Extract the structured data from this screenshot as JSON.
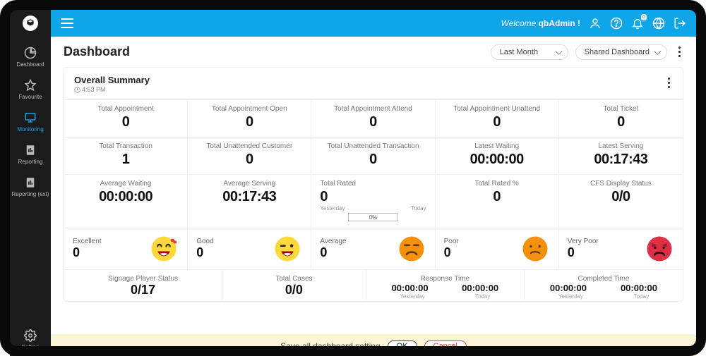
{
  "sidebar": {
    "items": [
      {
        "label": "Dashboard"
      },
      {
        "label": "Favourite"
      },
      {
        "label": "Monitoring"
      },
      {
        "label": "Reporting"
      },
      {
        "label": "Reporting (ext)"
      }
    ],
    "setting_label": "Setting"
  },
  "topbar": {
    "welcome_prefix": "Welcome",
    "user": "qbAdmin !",
    "notif_badge": "0"
  },
  "page": {
    "title": "Dashboard",
    "period_select": "Last Month",
    "dashboard_select": "Shared Dashboard"
  },
  "summary": {
    "title": "Overall Summary",
    "time": "4:53 PM",
    "row1": [
      {
        "label": "Total Appointment",
        "value": "0"
      },
      {
        "label": "Total Appointment Open",
        "value": "0"
      },
      {
        "label": "Total Appointment Attend",
        "value": "0"
      },
      {
        "label": "Total Appointment Unattend",
        "value": "0"
      },
      {
        "label": "Total Ticket",
        "value": "0"
      }
    ],
    "row2": [
      {
        "label": "Total Transaction",
        "value": "1"
      },
      {
        "label": "Total Unattended Customer",
        "value": "0"
      },
      {
        "label": "Total Unattended Transaction",
        "value": "0"
      },
      {
        "label": "Latest Waiting",
        "value": "00:00:00"
      },
      {
        "label": "Latest Serving",
        "value": "00:17:43"
      }
    ],
    "row3": [
      {
        "label": "Average Waiting",
        "value": "00:00:00"
      },
      {
        "label": "Average Serving",
        "value": "00:17:43"
      },
      {
        "label": "Total Rated",
        "value": "0",
        "yesterday_label": "Yesterday",
        "today_label": "Today",
        "percent": "0%"
      },
      {
        "label": "Total Rated %",
        "value": "0"
      },
      {
        "label": "CFS Display Status",
        "value": "0/0"
      }
    ],
    "ratings": [
      {
        "label": "Excellent",
        "value": "0"
      },
      {
        "label": "Good",
        "value": "0"
      },
      {
        "label": "Average",
        "value": "0"
      },
      {
        "label": "Poor",
        "value": "0"
      },
      {
        "label": "Very Poor",
        "value": "0"
      }
    ],
    "row4": [
      {
        "label": "Signage Player Status",
        "value": "0/17"
      },
      {
        "label": "Total Cases",
        "value": "0/0"
      },
      {
        "label": "Response Time",
        "left": "00:00:00",
        "right": "00:00:00",
        "left_lbl": "Yesterday",
        "right_lbl": "Today"
      },
      {
        "label": "Completed Time",
        "left": "00:00:00",
        "right": "00:00:00",
        "left_lbl": "Yesterday",
        "right_lbl": "Today"
      }
    ]
  },
  "save_bar": {
    "text": "Save all dashboard setting",
    "ok": "OK",
    "cancel": "Cancel"
  }
}
